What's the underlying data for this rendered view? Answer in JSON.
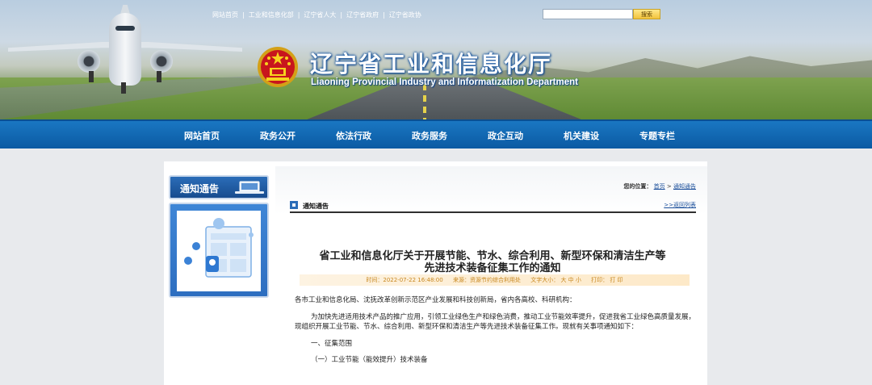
{
  "header": {
    "top_links": [
      "网站首页",
      "工业和信息化部",
      "辽宁省人大",
      "辽宁省政府",
      "辽宁省政协"
    ],
    "search": {
      "placeholder": "",
      "button": "搜索"
    },
    "title_cn": "辽宁省工业和信息化厅",
    "title_en": "Liaoning Provincial Industry and Informatization Department"
  },
  "nav": {
    "items": [
      "网站首页",
      "政务公开",
      "依法行政",
      "政务服务",
      "政企互动",
      "机关建设",
      "专题专栏"
    ]
  },
  "sidebar": {
    "title": "通知通告"
  },
  "main": {
    "location": {
      "label": "您的位置：",
      "home": "首页",
      "arrow": ">",
      "current": "通知通告"
    },
    "section_title": "通知通告",
    "back": ">>返回列表",
    "article": {
      "title_line1": "省工业和信息化厅关于开展节能、节水、综合利用、新型环保和清洁生产等",
      "title_line2": "先进技术装备征集工作的通知",
      "meta": {
        "time": "时间：2022-07-22 16:48:00",
        "source": "来源：资源节约综合利用处",
        "font_label": "文字大小：",
        "font_large": "大",
        "font_medium": "中",
        "font_small": "小",
        "print_label": "打印：",
        "print": "打 印"
      },
      "paragraphs": [
        "各市工业和信息化局、沈抚改革创新示范区产业发展和科技创新局，省内各高校、科研机构：",
        "为加快先进适用技术产品的推广应用，引领工业绿色生产和绿色消费，推动工业节能效率提升，促进我省工业绿色高质量发展，现组织开展工业节能、节水、综合利用、新型环保和清洁生产等先进技术装备征集工作。现就有关事项通知如下：",
        "一、征集范围",
        "（一）工业节能（能效提升）技术装备"
      ]
    }
  },
  "colors": {
    "nav_blue": "#0b5aa3",
    "link_blue": "#1a4e9a",
    "meta_orange": "#c8871f",
    "search_button": "#f2c33c"
  }
}
